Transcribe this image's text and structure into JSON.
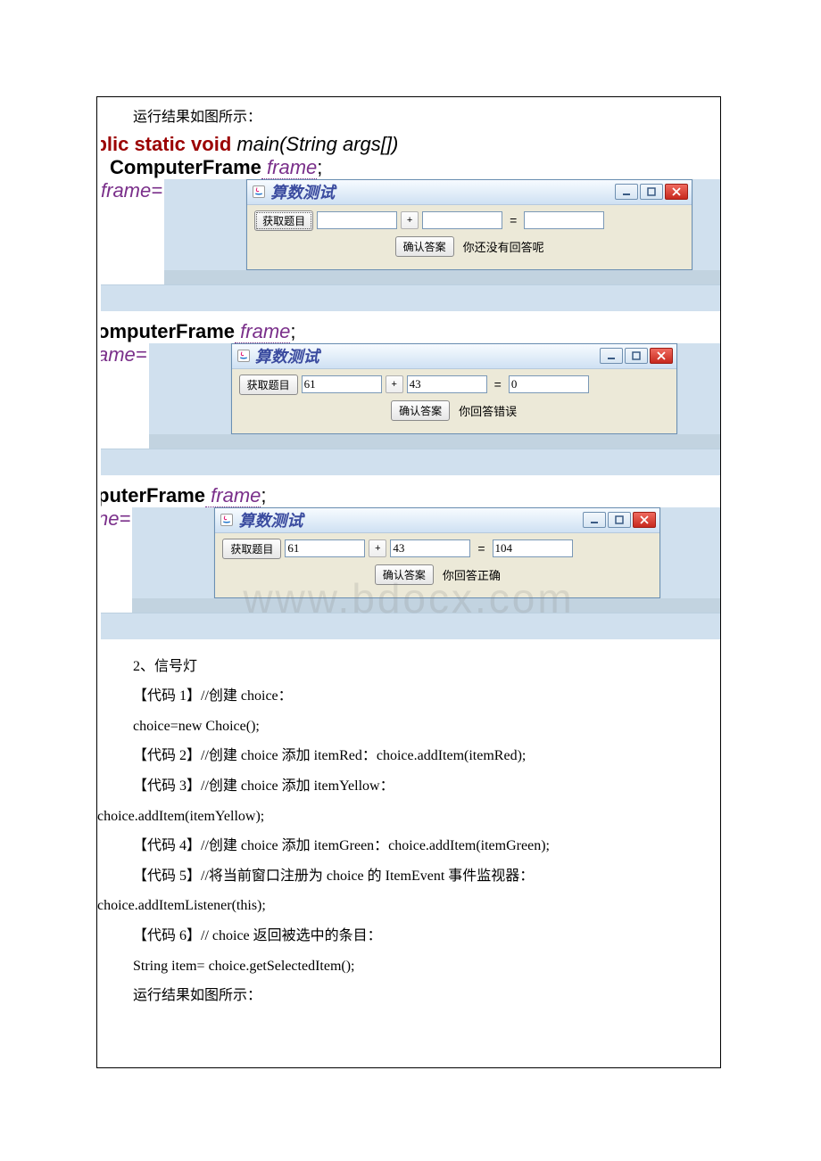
{
  "intro": "运行结果如图所示：",
  "code": {
    "block1": {
      "l1_kw": "ublic static void",
      "l1_rest": " main(String args[])",
      "l2_typ": "ComputerFrame",
      "l2_var": " frame",
      "l2_end": ";",
      "l3_pre": "frame="
    },
    "block2": {
      "l2_typ": "omputerFrame",
      "l2_var": " frame",
      "l2_end": ";",
      "l3_pre": "ame="
    },
    "block3": {
      "l2_typ": "puterFrame",
      "l2_var": " frame",
      "l2_end": ";",
      "l3_pre": "ne="
    }
  },
  "dialog": {
    "title": "算数测试",
    "get_btn": "获取题目",
    "confirm_btn": "确认答案",
    "plus": "+",
    "equals": "="
  },
  "states": [
    {
      "a": "",
      "b": "",
      "ans": "",
      "msg": "你还没有回答呢"
    },
    {
      "a": "61",
      "b": "43",
      "ans": "0",
      "msg": "你回答错误"
    },
    {
      "a": "61",
      "b": "43",
      "ans": "104",
      "msg": "你回答正确"
    }
  ],
  "section2": {
    "heading": "2、信号灯",
    "p1": "【代码 1】//创建 choice：",
    "p1b": "choice=new Choice();",
    "p2": "【代码 2】//创建 choice 添加 itemRed：choice.addItem(itemRed);",
    "p3a": "【代码 3】//创建 choice 添加 itemYellow：",
    "p3b": "choice.addItem(itemYellow);",
    "p4": "【代码 4】//创建 choice 添加 itemGreen：choice.addItem(itemGreen);",
    "p5a": "【代码 5】//将当前窗口注册为 choice 的 ItemEvent 事件监视器：",
    "p5b": "choice.addItemListener(this);",
    "p6": "【代码 6】// choice 返回被选中的条目：",
    "p6b": "String item= choice.getSelectedItem();",
    "p7": "运行结果如图所示："
  },
  "watermark": "www.bdocx.com"
}
